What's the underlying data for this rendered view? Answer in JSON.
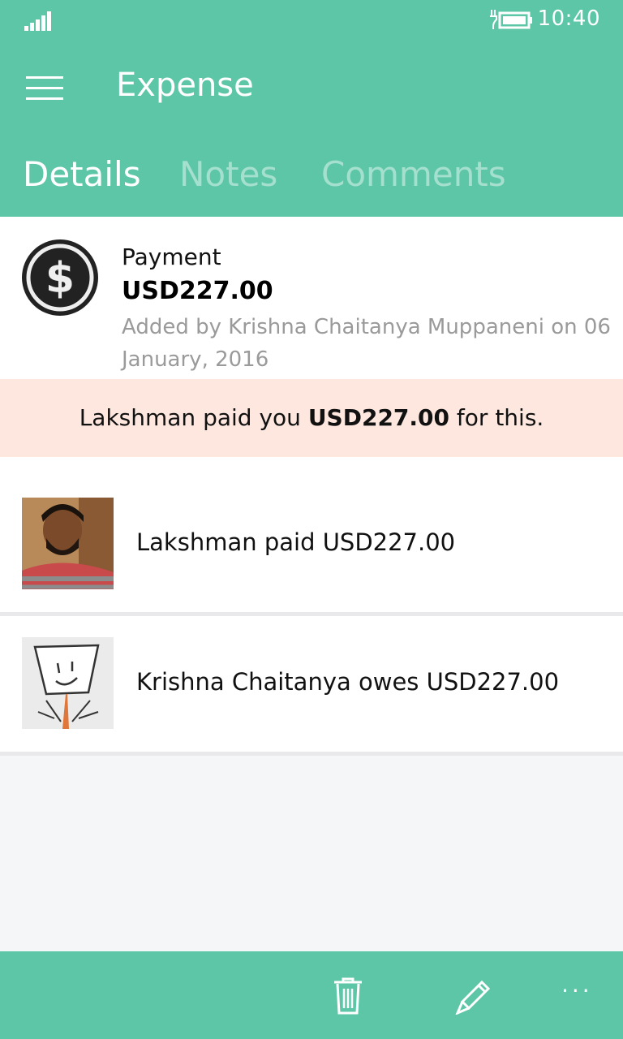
{
  "status_bar": {
    "time": "10:40",
    "icons": [
      "signal-icon",
      "battery-charging-icon"
    ]
  },
  "header": {
    "title": "Expense",
    "menu_icon": "hamburger-icon",
    "tabs": [
      {
        "label": "Details",
        "active": true
      },
      {
        "label": "Notes",
        "active": false
      },
      {
        "label": "Comments",
        "active": false
      }
    ]
  },
  "summary": {
    "icon": "dollar-icon",
    "type": "Payment",
    "amount": "USD227.00",
    "added_by": "Added by Krishna Chaitanya Muppaneni on 06 January, 2016"
  },
  "banner": {
    "prefix": "Lakshman paid you ",
    "amount": "USD227.00",
    "suffix": " for this."
  },
  "entries": [
    {
      "text": "Lakshman paid USD227.00",
      "avatar": "user-photo"
    },
    {
      "text": "Krishna Chaitanya owes USD227.00",
      "avatar": "sketch-avatar"
    }
  ],
  "app_bar": {
    "actions": [
      "trash-icon",
      "edit-icon",
      "more-icon"
    ],
    "more_label": "..."
  },
  "colors": {
    "accent": "#5cc6a7",
    "banner_bg": "#fde7df",
    "muted_text": "#9a9a9a",
    "page_bg": "#f5f6f8"
  }
}
